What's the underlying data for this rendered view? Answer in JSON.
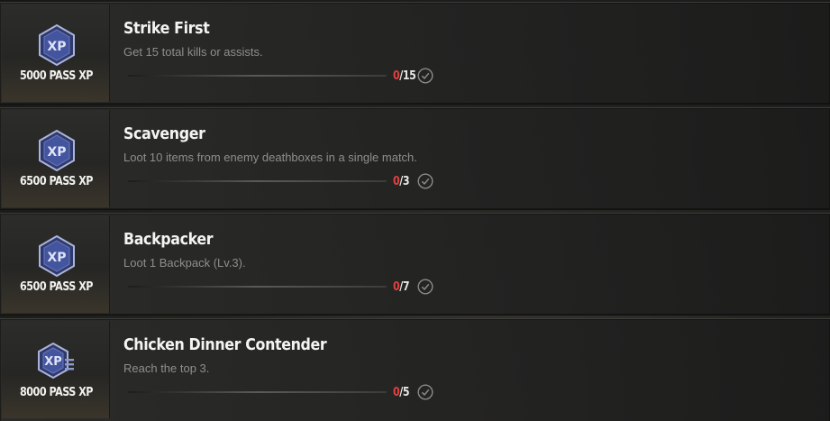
{
  "missions": [
    {
      "reward": "5000 PASS XP",
      "badge_icon": "xp-badge-icon",
      "title": "Strike First",
      "description": "Get 15 total kills or assists.",
      "current": "0",
      "separator": "/",
      "total": "15",
      "progress": 0
    },
    {
      "reward": "6500 PASS XP",
      "badge_icon": "xp-badge-icon",
      "title": "Scavenger",
      "description": "Loot 10 items from enemy deathboxes in a single match.",
      "current": "0",
      "separator": "/",
      "total": "3",
      "progress": 0
    },
    {
      "reward": "6500 PASS XP",
      "badge_icon": "xp-badge-icon",
      "title": "Backpacker",
      "description": "Loot 1 Backpack (Lv.3).",
      "current": "0",
      "separator": "/",
      "total": "7",
      "progress": 0
    },
    {
      "reward": "8000 PASS XP",
      "badge_icon": "xp-badge-plus-icon",
      "title": "Chicken Dinner Contender",
      "description": "Reach the top 3.",
      "current": "0",
      "separator": "/",
      "total": "5",
      "progress": 0
    }
  ],
  "colors": {
    "current_count": "#e0403f",
    "badge_fill": "#3b4a86",
    "badge_border": "#8d9ad0"
  }
}
